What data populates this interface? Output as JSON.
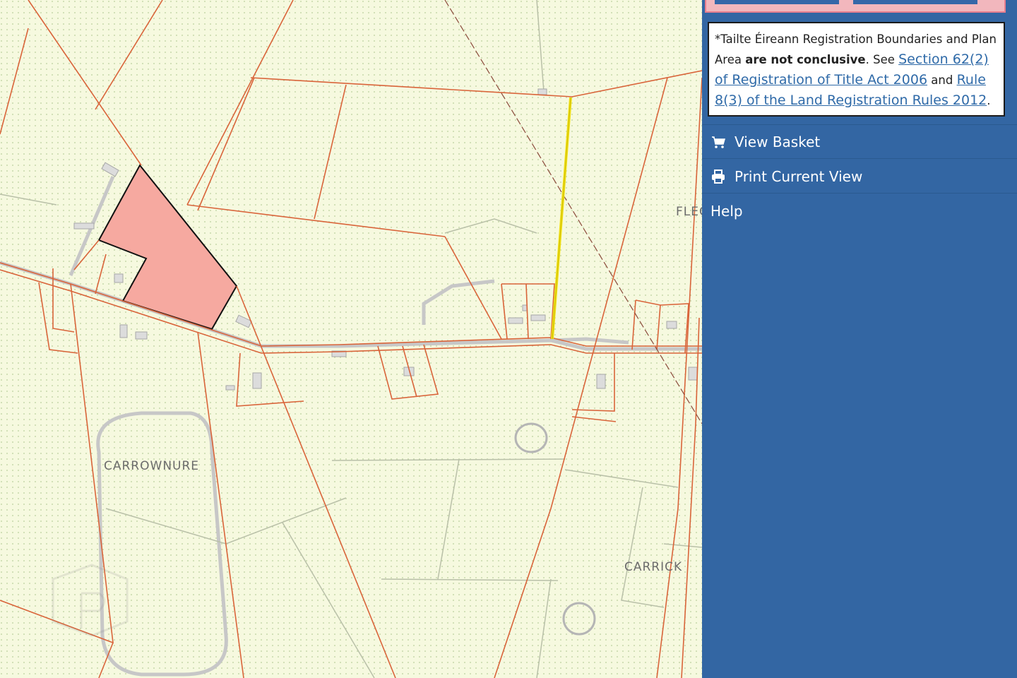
{
  "map": {
    "place_labels": [
      "CARROWNURE",
      "CARRICK",
      "FLEC"
    ]
  },
  "panel": {
    "disclaimer": {
      "part1": "*Tailte Éireann Registration Boundaries and Plan Area ",
      "bold": "are not conclusive",
      "part2": ". See ",
      "link1": "Section 62(2) of Registration of Title Act 2006",
      "and": " and ",
      "link2": "Rule 8(3) of the Land Registration Rules 2012",
      "end": "."
    },
    "menu": [
      {
        "label": "View Basket",
        "icon": "cart-icon"
      },
      {
        "label": "Print Current View",
        "icon": "printer-icon"
      },
      {
        "label": "Help",
        "icon": ""
      }
    ]
  },
  "colors": {
    "boundary": "#d9643a",
    "highlight_fill": "#f6a9a0",
    "selected_line": "#f2e21a",
    "panel": "#3366a3"
  }
}
